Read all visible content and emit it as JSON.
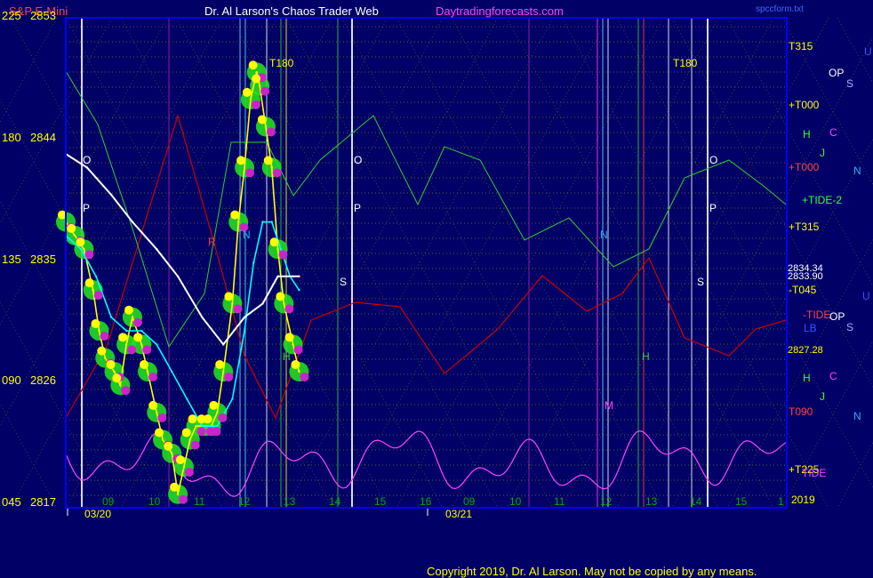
{
  "header": {
    "instrument": "S&P E-Mini",
    "title": "Dr. Al Larson's Chaos Trader Web",
    "site": "Daytradingforecasts.com",
    "right_tag": "spccform.txt"
  },
  "copyright": "Copyright 2019, Dr. Al Larson. May not be copied by any means.",
  "colors": {
    "background": "#000066",
    "plot_border": "#0000ff",
    "price": "#ffff00",
    "price_fast_avg": "#00ffff",
    "price_slow_avg": "#ffffff",
    "glow": "#22dd22",
    "tide": "#ff44ff",
    "red_line": "#cc0000",
    "green_line": "#33cc33",
    "grid_yellow": "#dddd00"
  },
  "y_axis": {
    "labels": [
      {
        "angle": "225",
        "price": "2853"
      },
      {
        "angle": "180",
        "price": "2844"
      },
      {
        "angle": "135",
        "price": "2835"
      },
      {
        "angle": "090",
        "price": "2826"
      },
      {
        "angle": "045",
        "price": "2817"
      }
    ]
  },
  "x_axis": {
    "hour_ticks": [
      "09",
      "10",
      "11",
      "12",
      "13",
      "14",
      "15",
      "16",
      "09",
      "10",
      "11",
      "12",
      "13",
      "14",
      "15",
      "1"
    ],
    "date_labels": [
      "03/20",
      "03/21"
    ]
  },
  "right_labels": [
    {
      "text": "T315",
      "color": "#ffff00"
    },
    {
      "text": "+T000",
      "color": "#ffff00"
    },
    {
      "text": "+T000",
      "color": "#ff4444"
    },
    {
      "text": "+TIDE-2",
      "color": "#33ff33"
    },
    {
      "text": "+T315",
      "color": "#ffff00"
    },
    {
      "text": "2834.34",
      "color": "#ffffff"
    },
    {
      "text": "2833.90",
      "color": "#ffffff"
    },
    {
      "text": "-T045",
      "color": "#ffff00"
    },
    {
      "text": "-TIDE",
      "color": "#ff4444"
    },
    {
      "text": "2827.28",
      "color": "#ffff00"
    },
    {
      "text": "T090",
      "color": "#ff4444"
    },
    {
      "text": "+T225",
      "color": "#ffff00"
    },
    {
      "text": "TIDE",
      "color": "#ff44ff"
    },
    {
      "text": "2019",
      "color": "#ffff00"
    }
  ],
  "planet_letters": [
    {
      "text": "U",
      "color": "#3355ff"
    },
    {
      "text": "OP",
      "color": "#ffffff"
    },
    {
      "text": "S",
      "color": "#aaaaff"
    },
    {
      "text": "H",
      "color": "#33ff33"
    },
    {
      "text": "C",
      "color": "#ff44ff"
    },
    {
      "text": "J",
      "color": "#33ff33"
    },
    {
      "text": "N",
      "color": "#33aaff"
    },
    {
      "text": "U",
      "color": "#3355ff"
    },
    {
      "text": "OP",
      "color": "#ffffff"
    },
    {
      "text": "LB",
      "color": "#3355ff"
    },
    {
      "text": "S",
      "color": "#aaaaff"
    },
    {
      "text": "H",
      "color": "#33ff33"
    },
    {
      "text": "C",
      "color": "#ff44ff"
    },
    {
      "text": "J",
      "color": "#33ff33"
    },
    {
      "text": "N",
      "color": "#33aaff"
    }
  ],
  "chart_annotations": [
    {
      "text": "T180",
      "color": "#ffff00"
    },
    {
      "text": "T180",
      "color": "#ffff00"
    },
    {
      "text": "O",
      "color": "#ffffff"
    },
    {
      "text": "P",
      "color": "#ffffff"
    },
    {
      "text": "O",
      "color": "#ffffff"
    },
    {
      "text": "P",
      "color": "#ffffff"
    },
    {
      "text": "O",
      "color": "#ffffff"
    },
    {
      "text": "P",
      "color": "#ffffff"
    },
    {
      "text": "S",
      "color": "#ffffff"
    },
    {
      "text": "S",
      "color": "#ffffff"
    },
    {
      "text": "N",
      "color": "#33aaff"
    },
    {
      "text": "N",
      "color": "#33aaff"
    },
    {
      "text": "H",
      "color": "#33cc33"
    },
    {
      "text": "H",
      "color": "#33cc33"
    },
    {
      "text": "R",
      "color": "#ff3333"
    },
    {
      "text": "M",
      "color": "#ff44ff"
    }
  ],
  "chart_data": {
    "type": "line",
    "title": "Dr. Al Larson's Chaos Trader Web",
    "subtitle": "S&P E-Mini",
    "ylim": [
      2817,
      2853
    ],
    "x_range_hours": [
      8.3,
      32.1
    ],
    "yticks": [
      2817,
      2826,
      2835,
      2844,
      2853
    ],
    "grid": true,
    "series": [
      {
        "name": "S&P E-Mini",
        "color": "#ffff00",
        "x": [
          8.3,
          8.6,
          8.9,
          9.2,
          9.4,
          9.6,
          9.9,
          10.1,
          10.3,
          10.5,
          10.8,
          11.0,
          11.3,
          11.5,
          11.8,
          12.0,
          12.2,
          12.4,
          12.6,
          12.9,
          13.1,
          13.3,
          13.5,
          13.8,
          14.0,
          14.2,
          14.4,
          14.6,
          14.7,
          14.9,
          15.1,
          15.3,
          15.5,
          15.8,
          16.0
        ],
        "values": [
          2838,
          2837,
          2836,
          2833,
          2830,
          2828,
          2827,
          2826,
          2829,
          2831,
          2829,
          2827,
          2824,
          2822,
          2821,
          2818,
          2820,
          2822,
          2823,
          2823,
          2823,
          2824,
          2827,
          2832,
          2838,
          2842,
          2847,
          2849,
          2848,
          2845,
          2842,
          2836,
          2832,
          2829,
          2827
        ]
      },
      {
        "name": "",
        "color": "#00ffff",
        "x": [
          8.3,
          8.8,
          9.3,
          9.8,
          10.3,
          10.8,
          11.3,
          11.8,
          12.3,
          12.8,
          13.3,
          13.8,
          14.2,
          14.5,
          14.8,
          15.1,
          15.4,
          15.7,
          16.0
        ],
        "values": [
          2837,
          2836,
          2834,
          2831,
          2830,
          2830,
          2829,
          2827,
          2825,
          2823,
          2823,
          2825,
          2830,
          2835,
          2838,
          2838,
          2836,
          2834,
          2833
        ]
      },
      {
        "name": "",
        "color": "#ffffff",
        "x": [
          8.3,
          9.0,
          9.8,
          10.5,
          11.3,
          12.0,
          12.8,
          13.5,
          14.2,
          14.8,
          15.3,
          15.8,
          16.0
        ],
        "values": [
          2843,
          2842,
          2840,
          2838,
          2836,
          2834,
          2831,
          2829,
          2831,
          2832,
          2834,
          2834,
          2834
        ]
      }
    ]
  }
}
